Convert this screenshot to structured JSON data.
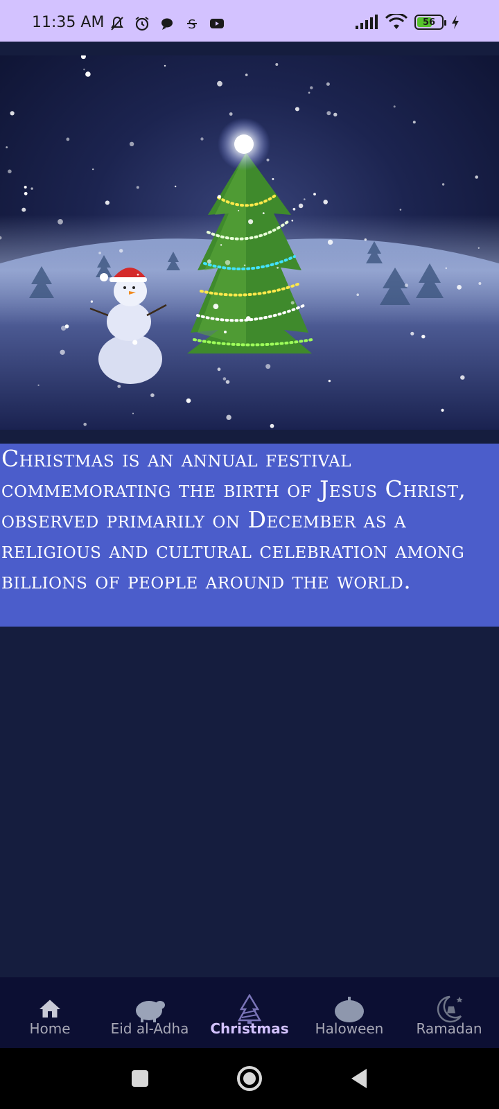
{
  "status_bar": {
    "time": "11:35 AM",
    "battery_percent": "56",
    "battery_level": 0.56,
    "left_icons": [
      "bell-off-icon",
      "alarm-icon",
      "chat-bubble-icon",
      "s-icon",
      "youtube-icon"
    ],
    "right_icons": [
      "signal-icon",
      "wifi-icon",
      "battery-icon",
      "charging-bolt-icon"
    ]
  },
  "hero": {
    "image_subject": "christmas-tree-snowman-image"
  },
  "description": {
    "text": "Christmas is an annual festival commemorating the birth of Jesus Christ, observed primarily on December as a religious and cultural celebration among billions of people around the world."
  },
  "bottom_nav": {
    "items": [
      {
        "label": "Home",
        "icon": "home-icon",
        "active": false
      },
      {
        "label": "Eid al-Adha",
        "icon": "sheep-icon",
        "active": false
      },
      {
        "label": "Christmas",
        "icon": "christmas-tree-icon",
        "active": true
      },
      {
        "label": "Haloween",
        "icon": "pumpkin-icon",
        "active": false
      },
      {
        "label": "Ramadan",
        "icon": "crescent-lantern-icon",
        "active": false
      }
    ]
  },
  "colors": {
    "status_bar_bg": "#d3c2ff",
    "page_bg": "#151d3e",
    "description_bg": "#4b5dcb",
    "nav_bg": "#0c0f33",
    "nav_active": "#d3c2ff",
    "nav_inactive": "#a8a8b6"
  }
}
